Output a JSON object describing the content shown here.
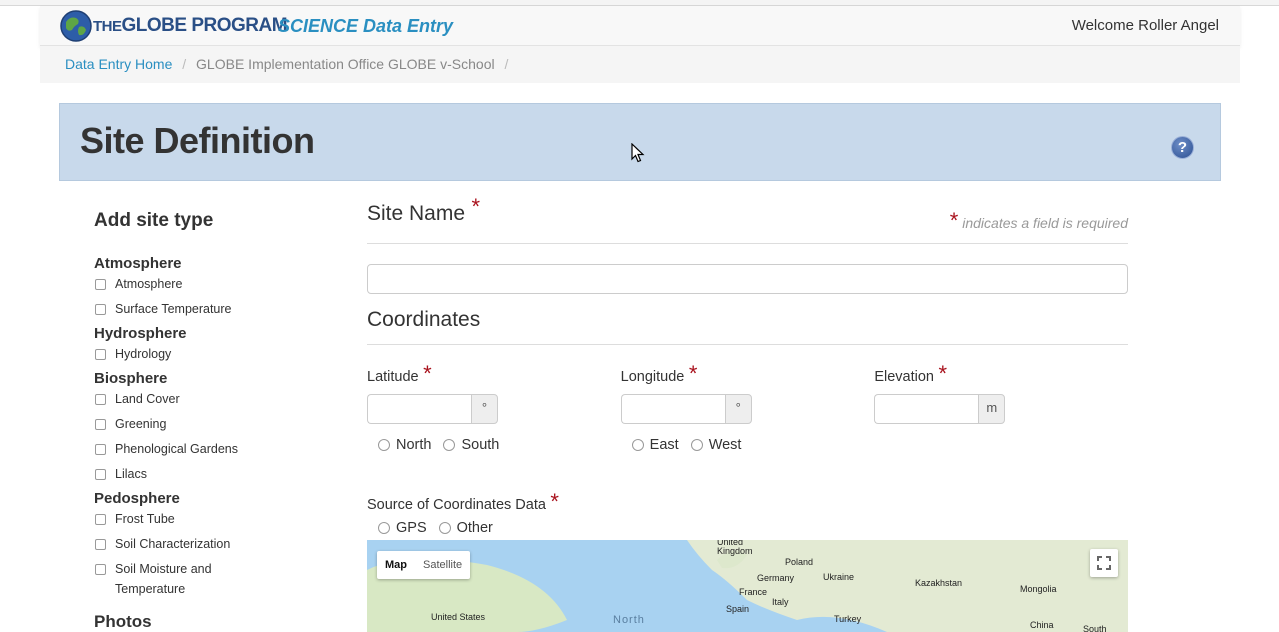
{
  "nav": {
    "logo_text_the": "THE",
    "logo_text_main": "GLOBE PROGRAM",
    "app_title": "SCIENCE Data Entry",
    "welcome": "Welcome Roller Angel"
  },
  "breadcrumb": {
    "home": "Data Entry Home",
    "current": "GLOBE Implementation Office GLOBE v-School",
    "separator": "/"
  },
  "header": {
    "title": "Site Definition",
    "help_glyph": "?"
  },
  "sidebar": {
    "title": "Add site type",
    "groups": [
      {
        "title": "Atmosphere",
        "items": [
          "Atmosphere",
          "Surface Temperature"
        ]
      },
      {
        "title": "Hydrosphere",
        "items": [
          "Hydrology"
        ]
      },
      {
        "title": "Biosphere",
        "items": [
          "Land Cover",
          "Greening",
          "Phenological Gardens",
          "Lilacs"
        ]
      },
      {
        "title": "Pedosphere",
        "items": [
          "Frost Tube",
          "Soil Characterization",
          "Soil Moisture and Temperature"
        ]
      }
    ],
    "next_group_partial": "Photos"
  },
  "form": {
    "site_name_label": "Site Name",
    "required_mark": "*",
    "required_note": "indicates a field is required",
    "site_name_value": "",
    "coordinates_title": "Coordinates",
    "latitude": {
      "label": "Latitude",
      "unit": "°",
      "value": "",
      "options": [
        "North",
        "South"
      ]
    },
    "longitude": {
      "label": "Longitude",
      "unit": "°",
      "value": "",
      "options": [
        "East",
        "West"
      ]
    },
    "elevation": {
      "label": "Elevation",
      "unit": "m",
      "value": ""
    },
    "source_label": "Source of Coordinates Data",
    "source_options": [
      "GPS",
      "Other"
    ]
  },
  "map": {
    "btn_map": "Map",
    "btn_satellite": "Satellite",
    "labels": [
      "United Kingdom",
      "Poland",
      "Germany",
      "Ukraine",
      "Kazakhstan",
      "Mongolia",
      "France",
      "Italy",
      "Spain",
      "Turkey",
      "China",
      "South Kore",
      "United States",
      "North"
    ]
  },
  "colors": {
    "accent": "#2a8fc1",
    "header_bg": "#c8d9eb",
    "required": "#a9121d"
  }
}
